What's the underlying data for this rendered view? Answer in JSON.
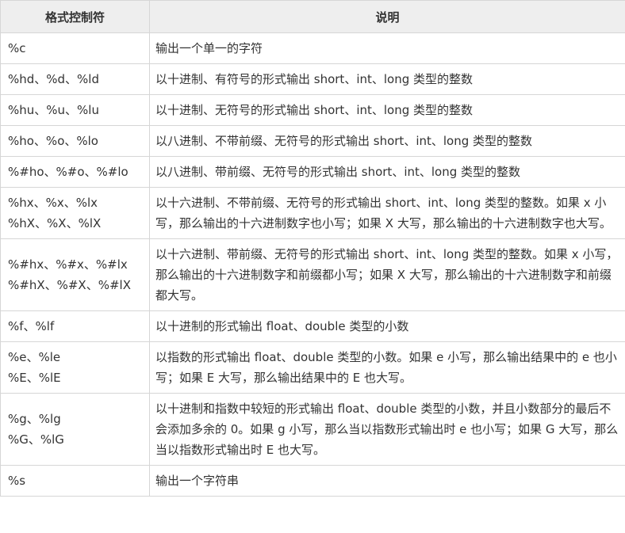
{
  "headers": {
    "spec": "格式控制符",
    "desc": "说明"
  },
  "rows": [
    {
      "spec": [
        "%c"
      ],
      "desc": "输出一个单一的字符"
    },
    {
      "spec": [
        "%hd、%d、%ld"
      ],
      "desc": "以十进制、有符号的形式输出 short、int、long 类型的整数"
    },
    {
      "spec": [
        "%hu、%u、%lu"
      ],
      "desc": "以十进制、无符号的形式输出 short、int、long 类型的整数"
    },
    {
      "spec": [
        "%ho、%o、%lo"
      ],
      "desc": "以八进制、不带前缀、无符号的形式输出 short、int、long 类型的整数"
    },
    {
      "spec": [
        "%#ho、%#o、%#lo"
      ],
      "desc": "以八进制、带前缀、无符号的形式输出 short、int、long 类型的整数"
    },
    {
      "spec": [
        "%hx、%x、%lx",
        "%hX、%X、%lX"
      ],
      "desc": "以十六进制、不带前缀、无符号的形式输出 short、int、long 类型的整数。如果 x 小写，那么输出的十六进制数字也小写；如果 X 大写，那么输出的十六进制数字也大写。"
    },
    {
      "spec": [
        "%#hx、%#x、%#lx",
        "%#hX、%#X、%#lX"
      ],
      "desc": "以十六进制、带前缀、无符号的形式输出 short、int、long 类型的整数。如果 x 小写，那么输出的十六进制数字和前缀都小写；如果 X 大写，那么输出的十六进制数字和前缀都大写。"
    },
    {
      "spec": [
        "%f、%lf"
      ],
      "desc": "以十进制的形式输出 float、double 类型的小数"
    },
    {
      "spec": [
        "%e、%le",
        "%E、%lE"
      ],
      "desc": "以指数的形式输出 float、double 类型的小数。如果 e 小写，那么输出结果中的 e 也小写；如果 E 大写，那么输出结果中的 E 也大写。"
    },
    {
      "spec": [
        "%g、%lg",
        "%G、%lG"
      ],
      "desc": "以十进制和指数中较短的形式输出 float、double 类型的小数，并且小数部分的最后不会添加多余的 0。如果 g 小写，那么当以指数形式输出时 e 也小写；如果 G 大写，那么当以指数形式输出时 E 也大写。"
    },
    {
      "spec": [
        "%s"
      ],
      "desc": "输出一个字符串"
    }
  ]
}
